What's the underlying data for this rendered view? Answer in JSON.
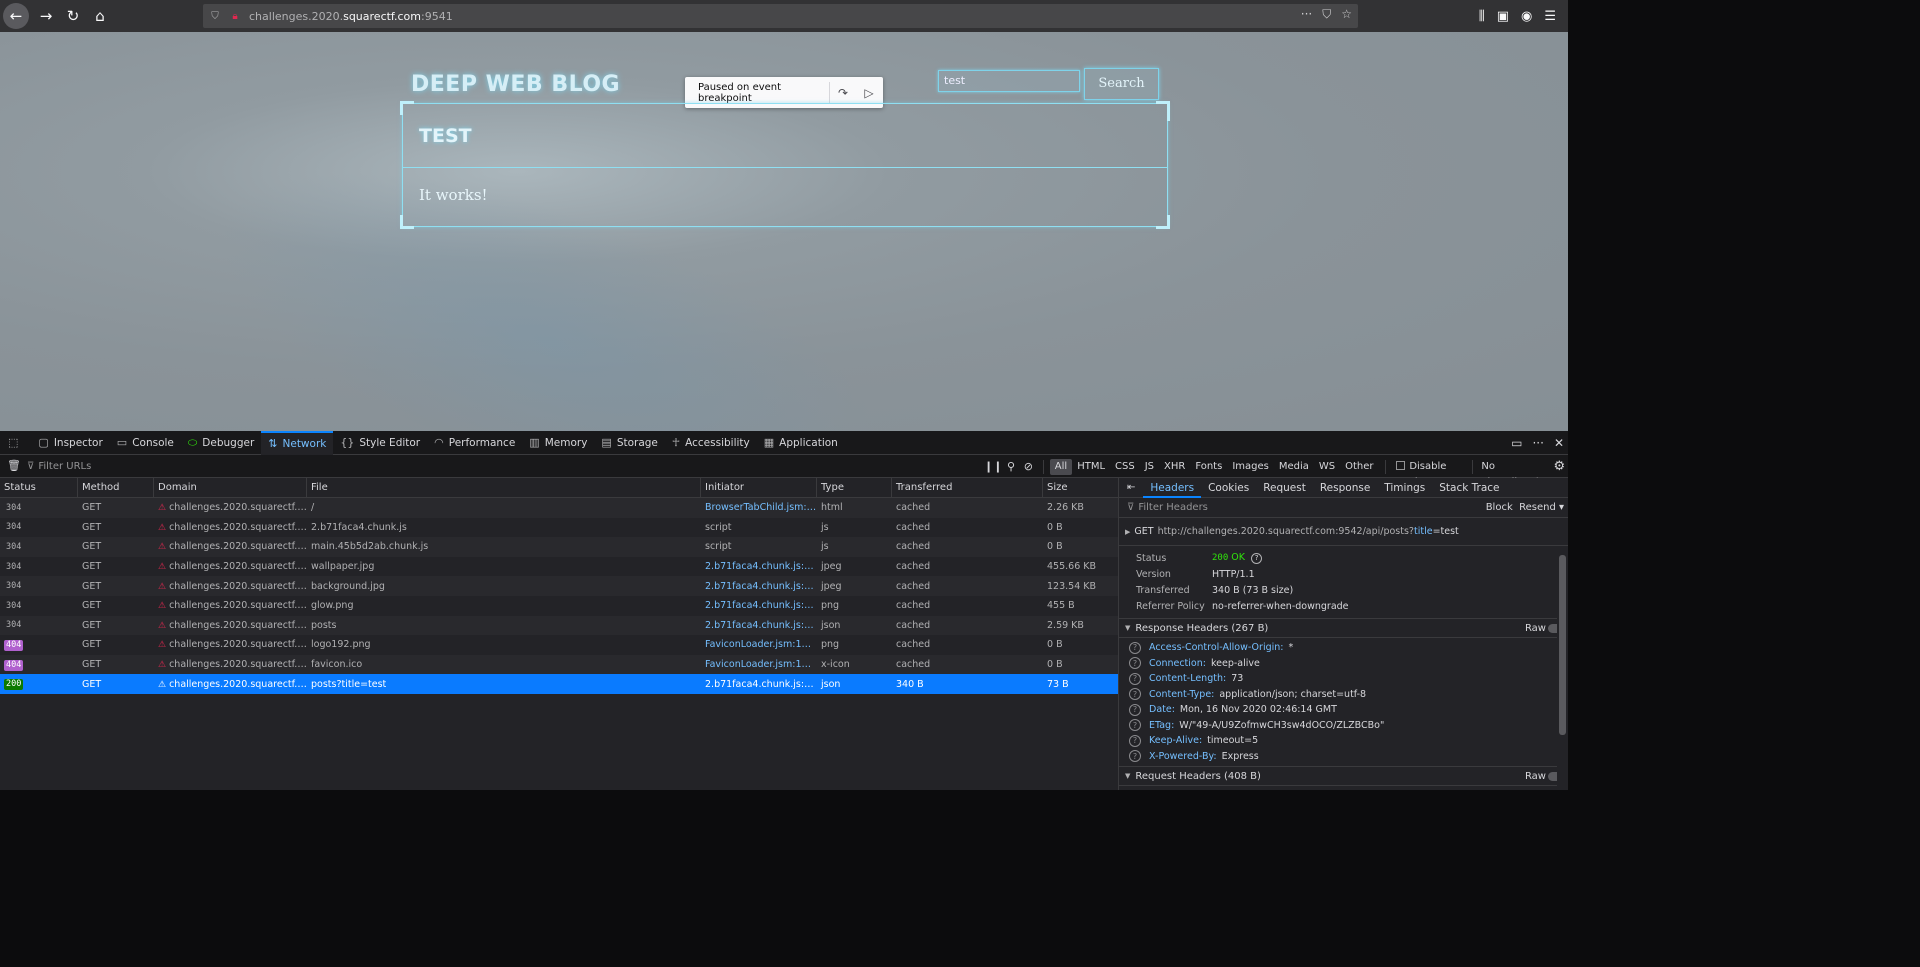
{
  "browser": {
    "url_prefix": "challenges.2020.",
    "url_host": "squarectf.com",
    "url_suffix": ":9541",
    "url_actions": [
      "···",
      "⛉",
      "☆"
    ]
  },
  "page": {
    "blog_title": "DEEP WEB BLOG",
    "paused_label": "Paused on event breakpoint",
    "search_value": "test",
    "search_button": "Search",
    "post_title": "TEST",
    "post_body": "It works!"
  },
  "devtools": {
    "tabs": [
      {
        "label": "Inspector",
        "icon": "inspector-icon"
      },
      {
        "label": "Console",
        "icon": "console-icon"
      },
      {
        "label": "Debugger",
        "icon": "debugger-icon"
      },
      {
        "label": "Network",
        "icon": "network-icon"
      },
      {
        "label": "Style Editor",
        "icon": "style-editor-icon"
      },
      {
        "label": "Performance",
        "icon": "performance-icon"
      },
      {
        "label": "Memory",
        "icon": "memory-icon"
      },
      {
        "label": "Storage",
        "icon": "storage-icon"
      },
      {
        "label": "Accessibility",
        "icon": "accessibility-icon"
      },
      {
        "label": "Application",
        "icon": "application-icon"
      }
    ],
    "filter_placeholder": "Filter URLs",
    "type_filters": [
      "All",
      "HTML",
      "CSS",
      "JS",
      "XHR",
      "Fonts",
      "Images",
      "Media",
      "WS",
      "Other"
    ],
    "disable_cache": "Disable Cache",
    "throttling": "No Throttling ⇕",
    "columns": [
      "Status",
      "Method",
      "Domain",
      "File",
      "Initiator",
      "Type",
      "Transferred",
      "Size"
    ],
    "rows": [
      {
        "status": "304",
        "method": "GET",
        "domain": "challenges.2020.squarectf.co...",
        "file": "/",
        "initiator": "BrowserTabChild.jsm:10...",
        "initiator_link": true,
        "type": "html",
        "transferred": "cached",
        "size": "2.26 KB"
      },
      {
        "status": "304",
        "method": "GET",
        "domain": "challenges.2020.squarectf.co...",
        "file": "2.b71faca4.chunk.js",
        "initiator": "script",
        "initiator_link": false,
        "type": "js",
        "transferred": "cached",
        "size": "0 B"
      },
      {
        "status": "304",
        "method": "GET",
        "domain": "challenges.2020.squarectf.co...",
        "file": "main.45b5d2ab.chunk.js",
        "initiator": "script",
        "initiator_link": false,
        "type": "js",
        "transferred": "cached",
        "size": "0 B"
      },
      {
        "status": "304",
        "method": "GET",
        "domain": "challenges.2020.squarectf.co...",
        "file": "wallpaper.jpg",
        "initiator": "2.b71faca4.chunk.js:2 (i...",
        "initiator_link": true,
        "type": "jpeg",
        "transferred": "cached",
        "size": "455.66 KB"
      },
      {
        "status": "304",
        "method": "GET",
        "domain": "challenges.2020.squarectf.co...",
        "file": "background.jpg",
        "initiator": "2.b71faca4.chunk.js:2 (i...",
        "initiator_link": true,
        "type": "jpeg",
        "transferred": "cached",
        "size": "123.54 KB"
      },
      {
        "status": "304",
        "method": "GET",
        "domain": "challenges.2020.squarectf.co...",
        "file": "glow.png",
        "initiator": "2.b71faca4.chunk.js:2 (i...",
        "initiator_link": true,
        "type": "png",
        "transferred": "cached",
        "size": "455 B"
      },
      {
        "status": "304",
        "method": "GET",
        "domain": "challenges.2020.squarectf.co...",
        "file": "posts",
        "initiator": "2.b71faca4.chunk.js:2 (x...",
        "initiator_link": true,
        "type": "json",
        "transferred": "cached",
        "size": "2.59 KB"
      },
      {
        "status": "404",
        "method": "GET",
        "domain": "challenges.2020.squarectf.co...",
        "file": "logo192.png",
        "initiator": "FaviconLoader.jsm:179 (i...",
        "initiator_link": true,
        "type": "png",
        "transferred": "cached",
        "size": "0 B"
      },
      {
        "status": "404",
        "method": "GET",
        "domain": "challenges.2020.squarectf.co...",
        "file": "favicon.ico",
        "initiator": "FaviconLoader.jsm:179 (i...",
        "initiator_link": true,
        "type": "x-icon",
        "transferred": "cached",
        "size": "0 B"
      },
      {
        "status": "200",
        "method": "GET",
        "domain": "challenges.2020.squarectf.co...",
        "file": "posts?title=test",
        "initiator": "2.b71faca4.chunk.js:2 (x...",
        "initiator_link": true,
        "type": "json",
        "transferred": "340 B",
        "size": "73 B",
        "selected": true
      }
    ],
    "side_tabs": [
      "Headers",
      "Cookies",
      "Request",
      "Response",
      "Timings",
      "Stack Trace"
    ],
    "filter_headers_placeholder": "Filter Headers",
    "block_label": "Block",
    "resend_label": "Resend ▾",
    "request_method": "GET",
    "request_url": "http://challenges.2020.squarectf.com:9542/api/posts?",
    "request_query_key": "title",
    "request_query_val": "=test",
    "summary": [
      {
        "k": "Status",
        "v": "OK",
        "code": "200"
      },
      {
        "k": "Version",
        "v": "HTTP/1.1"
      },
      {
        "k": "Transferred",
        "v": "340 B (73 B size)"
      },
      {
        "k": "Referrer Policy",
        "v": "no-referrer-when-downgrade"
      }
    ],
    "response_headers_title": "Response Headers (267 B)",
    "request_headers_title": "Request Headers (408 B)",
    "raw_label": "Raw",
    "response_headers": [
      {
        "k": "Access-Control-Allow-Origin:",
        "v": "*"
      },
      {
        "k": "Connection:",
        "v": "keep-alive"
      },
      {
        "k": "Content-Length:",
        "v": "73"
      },
      {
        "k": "Content-Type:",
        "v": "application/json; charset=utf-8"
      },
      {
        "k": "Date:",
        "v": "Mon, 16 Nov 2020 02:46:14 GMT"
      },
      {
        "k": "ETag:",
        "v": "W/\"49-A/U9ZofmwCH3sw4dOCO/ZLZBCBo\""
      },
      {
        "k": "Keep-Alive:",
        "v": "timeout=5"
      },
      {
        "k": "X-Powered-By:",
        "v": "Express"
      }
    ]
  }
}
